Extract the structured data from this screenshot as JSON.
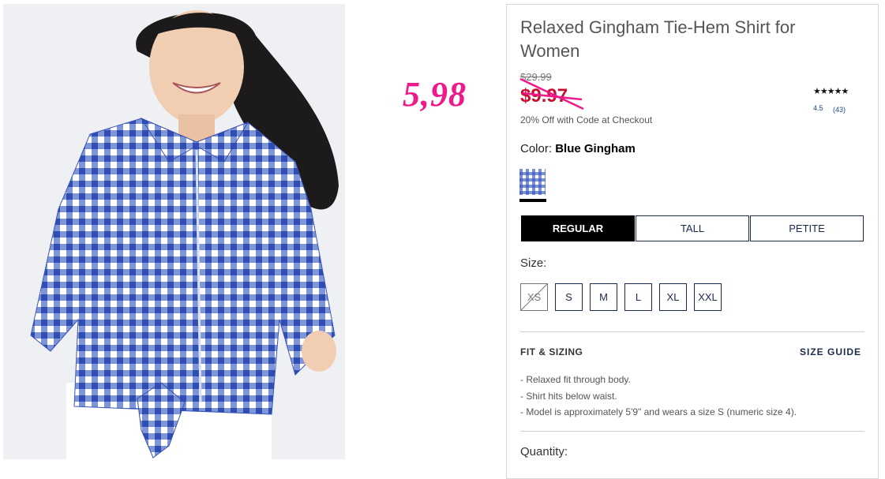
{
  "annotation": {
    "text": "5,98",
    "color": "#ee1a8c"
  },
  "product": {
    "title": "Relaxed Gingham Tie-Hem Shirt for Women",
    "price_original": "$29.99",
    "price_sale": "$9.97",
    "promo": "20% Off with Code at Checkout",
    "rating": {
      "stars": "★★★★★",
      "value": "4.5",
      "count": "(43)"
    },
    "color": {
      "label": "Color:",
      "value": "Blue Gingham"
    },
    "fit_tabs": [
      "REGULAR",
      "TALL",
      "PETITE"
    ],
    "selected_fit": "REGULAR",
    "size_label": "Size:",
    "sizes": [
      "XS",
      "S",
      "M",
      "L",
      "XL",
      "XXL"
    ],
    "fit_sizing": {
      "heading": "FIT & SIZING",
      "size_guide": "SIZE GUIDE",
      "bullets": [
        "Relaxed fit through body.",
        "Shirt hits below waist.",
        "Model is approximately 5'9\" and wears a size S (numeric size 4)."
      ]
    },
    "quantity_label": "Quantity:"
  },
  "colors": {
    "sale": "#c8102e",
    "navy": "#1b2a4a",
    "annotation": "#ee1a8c"
  }
}
